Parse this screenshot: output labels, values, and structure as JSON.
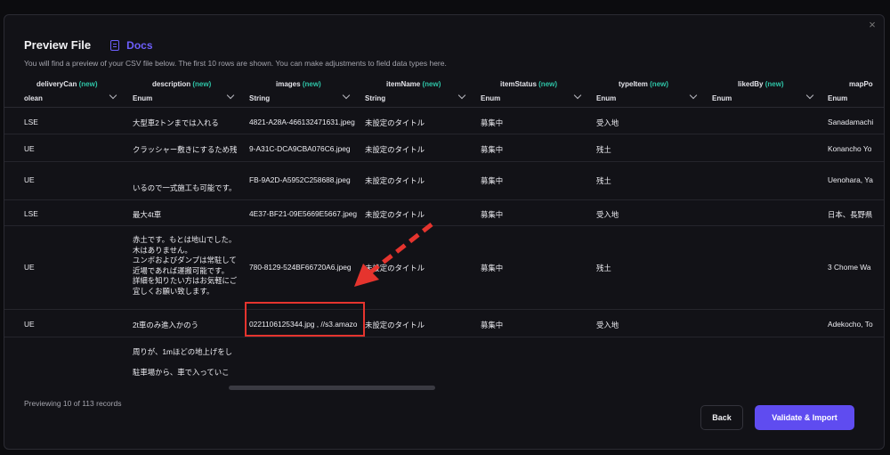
{
  "modal": {
    "title": "Preview File",
    "docs_label": "Docs",
    "subtitle": "You will find a preview of your CSV file below. The first 10 rows are shown. You can make adjustments to field data types here.",
    "close_glyph": "×",
    "new_tag": "(new)"
  },
  "columns": [
    {
      "name": "deliveryCan",
      "type": "olean"
    },
    {
      "name": "description",
      "type": "Enum"
    },
    {
      "name": "images",
      "type": "String"
    },
    {
      "name": "itemName",
      "type": "String"
    },
    {
      "name": "itemStatus",
      "type": "Enum"
    },
    {
      "name": "typeItem",
      "type": "Enum"
    },
    {
      "name": "likedBy",
      "type": "Enum"
    },
    {
      "name": "mapPo",
      "type": "Enum"
    }
  ],
  "rows": [
    {
      "c0": "LSE",
      "c1": "大型車2トンまでは入れる",
      "c2": "4821-A28A-466132471631.jpeg",
      "c3": "未設定のタイトル",
      "c4": "募集中",
      "c5": "受入地",
      "c7": "Sanadamachi"
    },
    {
      "c0": "UE",
      "c1": "クラッシャー敷きにするため残",
      "c2": "9-A31C-DCA9CBA076C6.jpeg",
      "c3": "未設定のタイトル",
      "c4": "募集中",
      "c5": "残土",
      "c7": "Konancho Yo"
    },
    {
      "c0": "UE",
      "c1": "いるので一式施工も可能です。",
      "c2": "FB-9A2D-A5952C258688.jpeg",
      "c3": "未設定のタイトル",
      "c4": "募集中",
      "c5": "残土",
      "c7": "Uenohara, Ya"
    },
    {
      "c0": "LSE",
      "c1": "最大4t車",
      "c2": "4E37-BF21-09E5669E5667.jpeg",
      "c3": "未設定のタイトル",
      "c4": "募集中",
      "c5": "受入地",
      "c7": "日本、長野県"
    },
    {
      "c0": "UE",
      "c1": "赤土です。もとは地山でした。\n木はありません。\nユンボおよびダンプは常駐して\n近場であれば運搬可能です。\n詳細を知りたい方はお気軽にご\n宜しくお願い致します。",
      "c2": "780-8129-524BF66720A6.jpeg",
      "c3": "未設定のタイトル",
      "c4": "募集中",
      "c5": "残土",
      "c7": "3 Chome Wa"
    },
    {
      "c0": "UE",
      "c1": "2t車のみ進入かのう",
      "c2": "0221106125344.jpg , //s3.amazo",
      "c3": "未設定のタイトル",
      "c4": "募集中",
      "c5": "受入地",
      "c7": "Adekocho, To"
    },
    {
      "c0": "",
      "c1": "周りが、1mほどの地上げをし\n\n駐車場から、車で入っていこ",
      "c2": "",
      "c3": "",
      "c4": "",
      "c5": "",
      "c7": ""
    }
  ],
  "footer": {
    "previewing": "Previewing 10 of 113 records",
    "back_label": "Back",
    "validate_label": "Validate & Import"
  },
  "colors": {
    "accent": "#5f4cf0",
    "new_tag": "#2ec4a7",
    "annotation": "#e5342e"
  }
}
